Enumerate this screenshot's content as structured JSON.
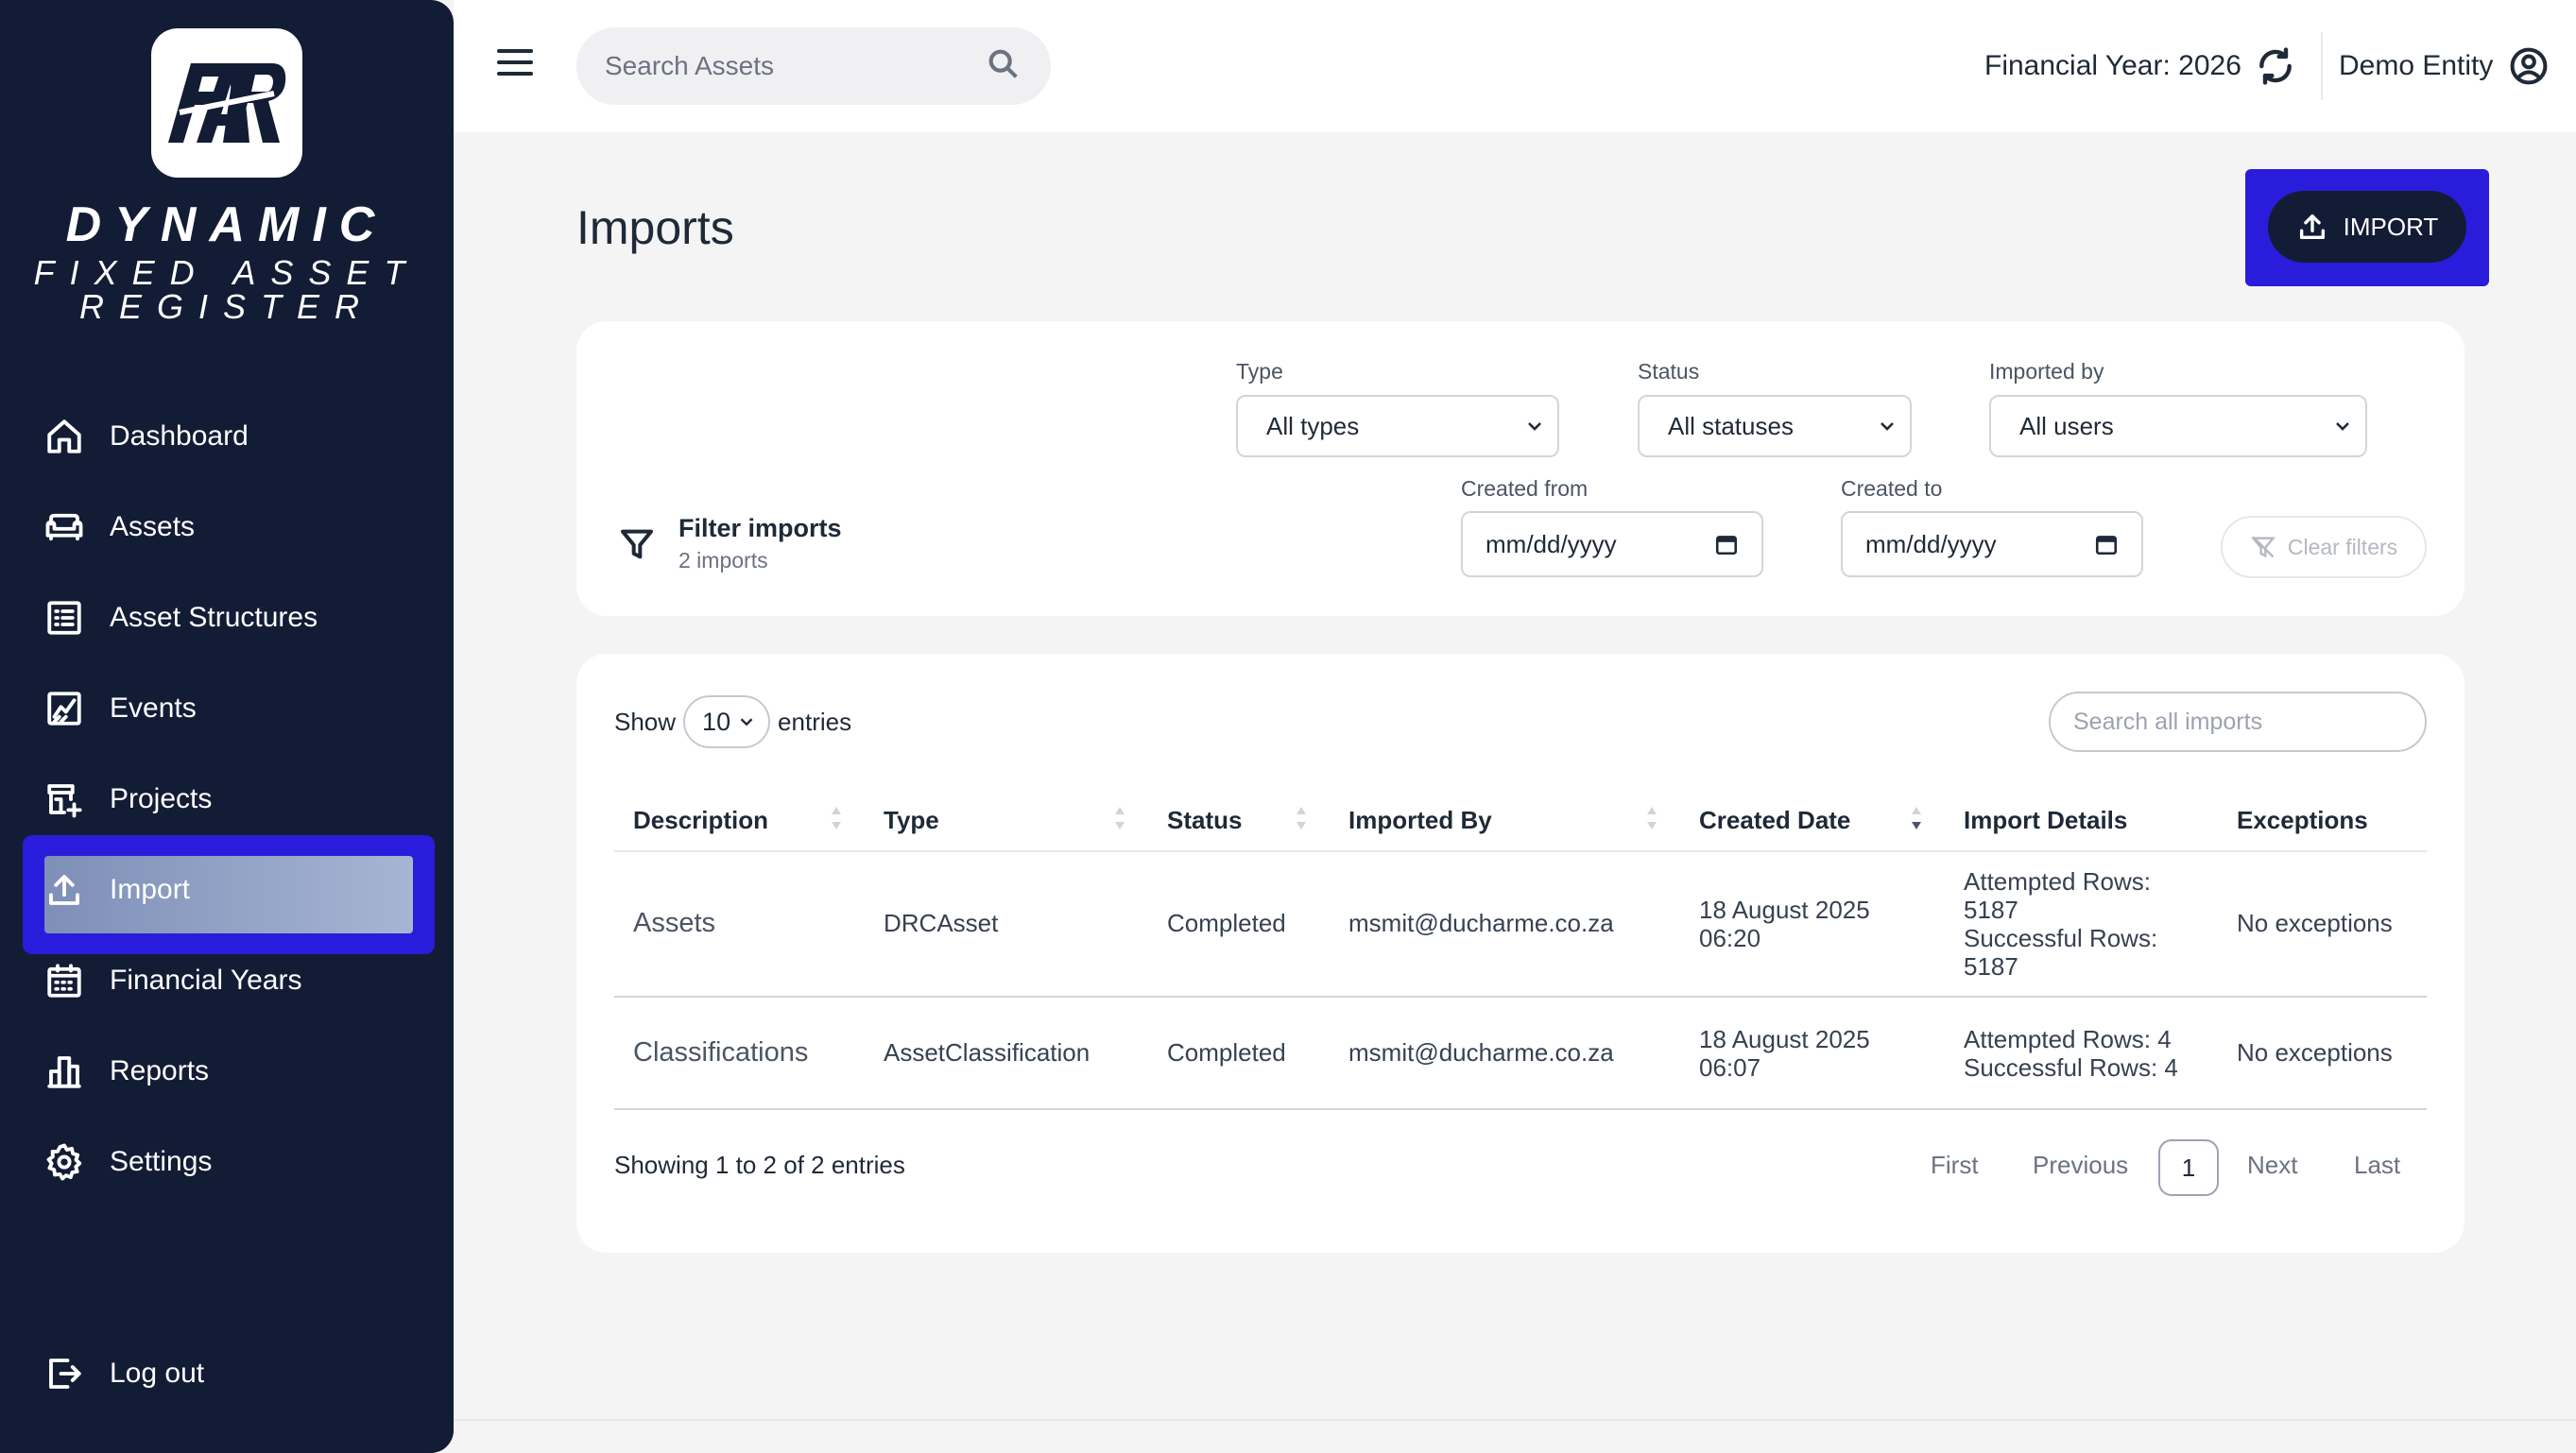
{
  "brand": {
    "logo_text": "FAR",
    "line1": "DYNAMIC",
    "line2": "FIXED ASSET",
    "line3": "REGISTER"
  },
  "sidebar": {
    "items": [
      {
        "label": "Dashboard",
        "icon": "home-icon"
      },
      {
        "label": "Assets",
        "icon": "sofa-icon"
      },
      {
        "label": "Asset Structures",
        "icon": "list-icon"
      },
      {
        "label": "Events",
        "icon": "chart-line-icon"
      },
      {
        "label": "Projects",
        "icon": "building-add-icon"
      },
      {
        "label": "Import",
        "icon": "upload-icon",
        "active": true
      },
      {
        "label": "Financial Years",
        "icon": "calendar-icon"
      },
      {
        "label": "Reports",
        "icon": "bar-chart-icon"
      },
      {
        "label": "Settings",
        "icon": "gear-icon"
      }
    ],
    "logout": "Log out"
  },
  "header": {
    "search_placeholder": "Search Assets",
    "financial_year": "Financial Year: 2026",
    "entity": "Demo Entity"
  },
  "page": {
    "title": "Imports",
    "import_button": "IMPORT"
  },
  "filters": {
    "title": "Filter imports",
    "subtitle": "2 imports",
    "type_label": "Type",
    "type_value": "All types",
    "status_label": "Status",
    "status_value": "All statuses",
    "imported_by_label": "Imported by",
    "imported_by_value": "All users",
    "created_from_label": "Created from",
    "created_from_value": "mm/dd/yyyy",
    "created_to_label": "Created to",
    "created_to_value": "mm/dd/yyyy",
    "clear": "Clear filters"
  },
  "table": {
    "show_label": "Show",
    "page_size": "10",
    "entries_label": "entries",
    "search_placeholder": "Search all imports",
    "columns": [
      "Description",
      "Type",
      "Status",
      "Imported By",
      "Created Date",
      "Import Details",
      "Exceptions"
    ],
    "rows": [
      {
        "description": "Assets",
        "type": "DRCAsset",
        "status": "Completed",
        "imported_by": "msmit@ducharme.co.za",
        "created_date_1": "18 August 2025",
        "created_date_2": "06:20",
        "details_1": "Attempted Rows:",
        "details_2": "5187",
        "details_3": "Successful Rows:",
        "details_4": "5187",
        "exceptions": "No exceptions"
      },
      {
        "description": "Classifications",
        "type": "AssetClassification",
        "status": "Completed",
        "imported_by": "msmit@ducharme.co.za",
        "created_date_1": "18 August 2025",
        "created_date_2": "06:07",
        "details_1": "Attempted Rows: 4",
        "details_2": "Successful Rows: 4",
        "exceptions": "No exceptions"
      }
    ],
    "showing": "Showing 1 to 2 of 2 entries",
    "pagination": {
      "first": "First",
      "previous": "Previous",
      "current": "1",
      "next": "Next",
      "last": "Last"
    }
  },
  "colors": {
    "sidebar_bg": "#131c35",
    "highlight": "#2a1cdb",
    "button_bg": "#131c35"
  }
}
